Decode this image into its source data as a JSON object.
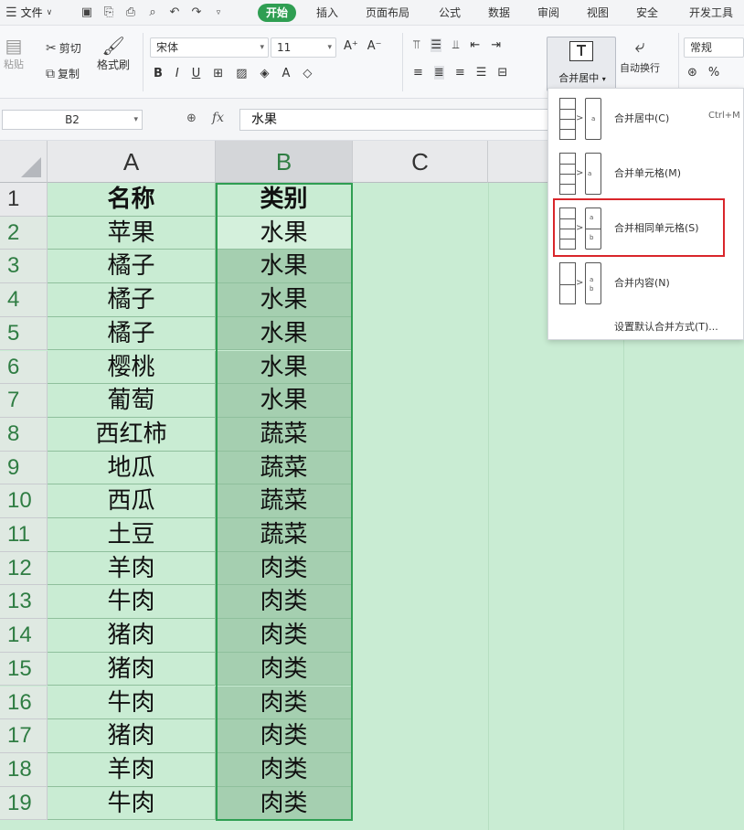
{
  "menubar": {
    "file_label": "文件",
    "tabs": [
      "开始",
      "插入",
      "页面布局",
      "公式",
      "数据",
      "审阅",
      "视图",
      "安全",
      "开发工具"
    ],
    "active_tab": "开始"
  },
  "ribbon": {
    "paste_label": "粘贴",
    "cut_label": "剪切",
    "copy_label": "复制",
    "format_painter_label": "格式刷",
    "font_name": "宋体",
    "font_size": "11",
    "merge_label": "合并居中",
    "wrap_label": "自动换行",
    "number_format": "常规"
  },
  "formula_bar": {
    "cell_ref": "B2",
    "fx_label": "fx",
    "formula_value": "水果"
  },
  "grid": {
    "columns": [
      "A",
      "B",
      "C"
    ],
    "rows": [
      {
        "num": "1",
        "a": "名称",
        "b": "类别"
      },
      {
        "num": "2",
        "a": "苹果",
        "b": "水果"
      },
      {
        "num": "3",
        "a": "橘子",
        "b": "水果"
      },
      {
        "num": "4",
        "a": "橘子",
        "b": "水果"
      },
      {
        "num": "5",
        "a": "橘子",
        "b": "水果"
      },
      {
        "num": "6",
        "a": "樱桃",
        "b": "水果"
      },
      {
        "num": "7",
        "a": "葡萄",
        "b": "水果"
      },
      {
        "num": "8",
        "a": "西红柿",
        "b": "蔬菜"
      },
      {
        "num": "9",
        "a": "地瓜",
        "b": "蔬菜"
      },
      {
        "num": "10",
        "a": "西瓜",
        "b": "蔬菜"
      },
      {
        "num": "11",
        "a": "土豆",
        "b": "蔬菜"
      },
      {
        "num": "12",
        "a": "羊肉",
        "b": "肉类"
      },
      {
        "num": "13",
        "a": "牛肉",
        "b": "肉类"
      },
      {
        "num": "14",
        "a": "猪肉",
        "b": "肉类"
      },
      {
        "num": "15",
        "a": "猪肉",
        "b": "肉类"
      },
      {
        "num": "16",
        "a": "牛肉",
        "b": "肉类"
      },
      {
        "num": "17",
        "a": "猪肉",
        "b": "肉类"
      },
      {
        "num": "18",
        "a": "羊肉",
        "b": "肉类"
      },
      {
        "num": "19",
        "a": "牛肉",
        "b": "肉类"
      }
    ]
  },
  "merge_menu": {
    "items": [
      {
        "label": "合并居中(C)",
        "shortcut": "Ctrl+M"
      },
      {
        "label": "合并单元格(M)",
        "shortcut": ""
      },
      {
        "label": "合并相同单元格(S)",
        "shortcut": ""
      },
      {
        "label": "合并内容(N)",
        "shortcut": ""
      }
    ],
    "default_label": "设置默认合并方式(T)...",
    "highlighted_item": "合并相同单元格(S)"
  },
  "colors": {
    "accent": "#2f9e52",
    "highlight_box": "#d9262b",
    "grid_bg": "#c9ecd3"
  }
}
